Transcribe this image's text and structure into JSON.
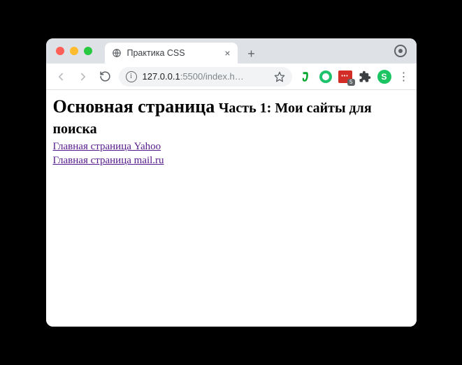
{
  "tab": {
    "title": "Практика CSS"
  },
  "address": {
    "host": "127.0.0.1",
    "port_path": ":5500/index.h…"
  },
  "extensions": {
    "lastpass_badge": "5",
    "profile_letter": "S"
  },
  "page": {
    "h1": "Основная страница",
    "h2": "Часть 1: Мои сайты для поиска",
    "links": [
      {
        "text": "Главная страница Yahoo"
      },
      {
        "text": "Главная страница mail.ru"
      }
    ]
  }
}
